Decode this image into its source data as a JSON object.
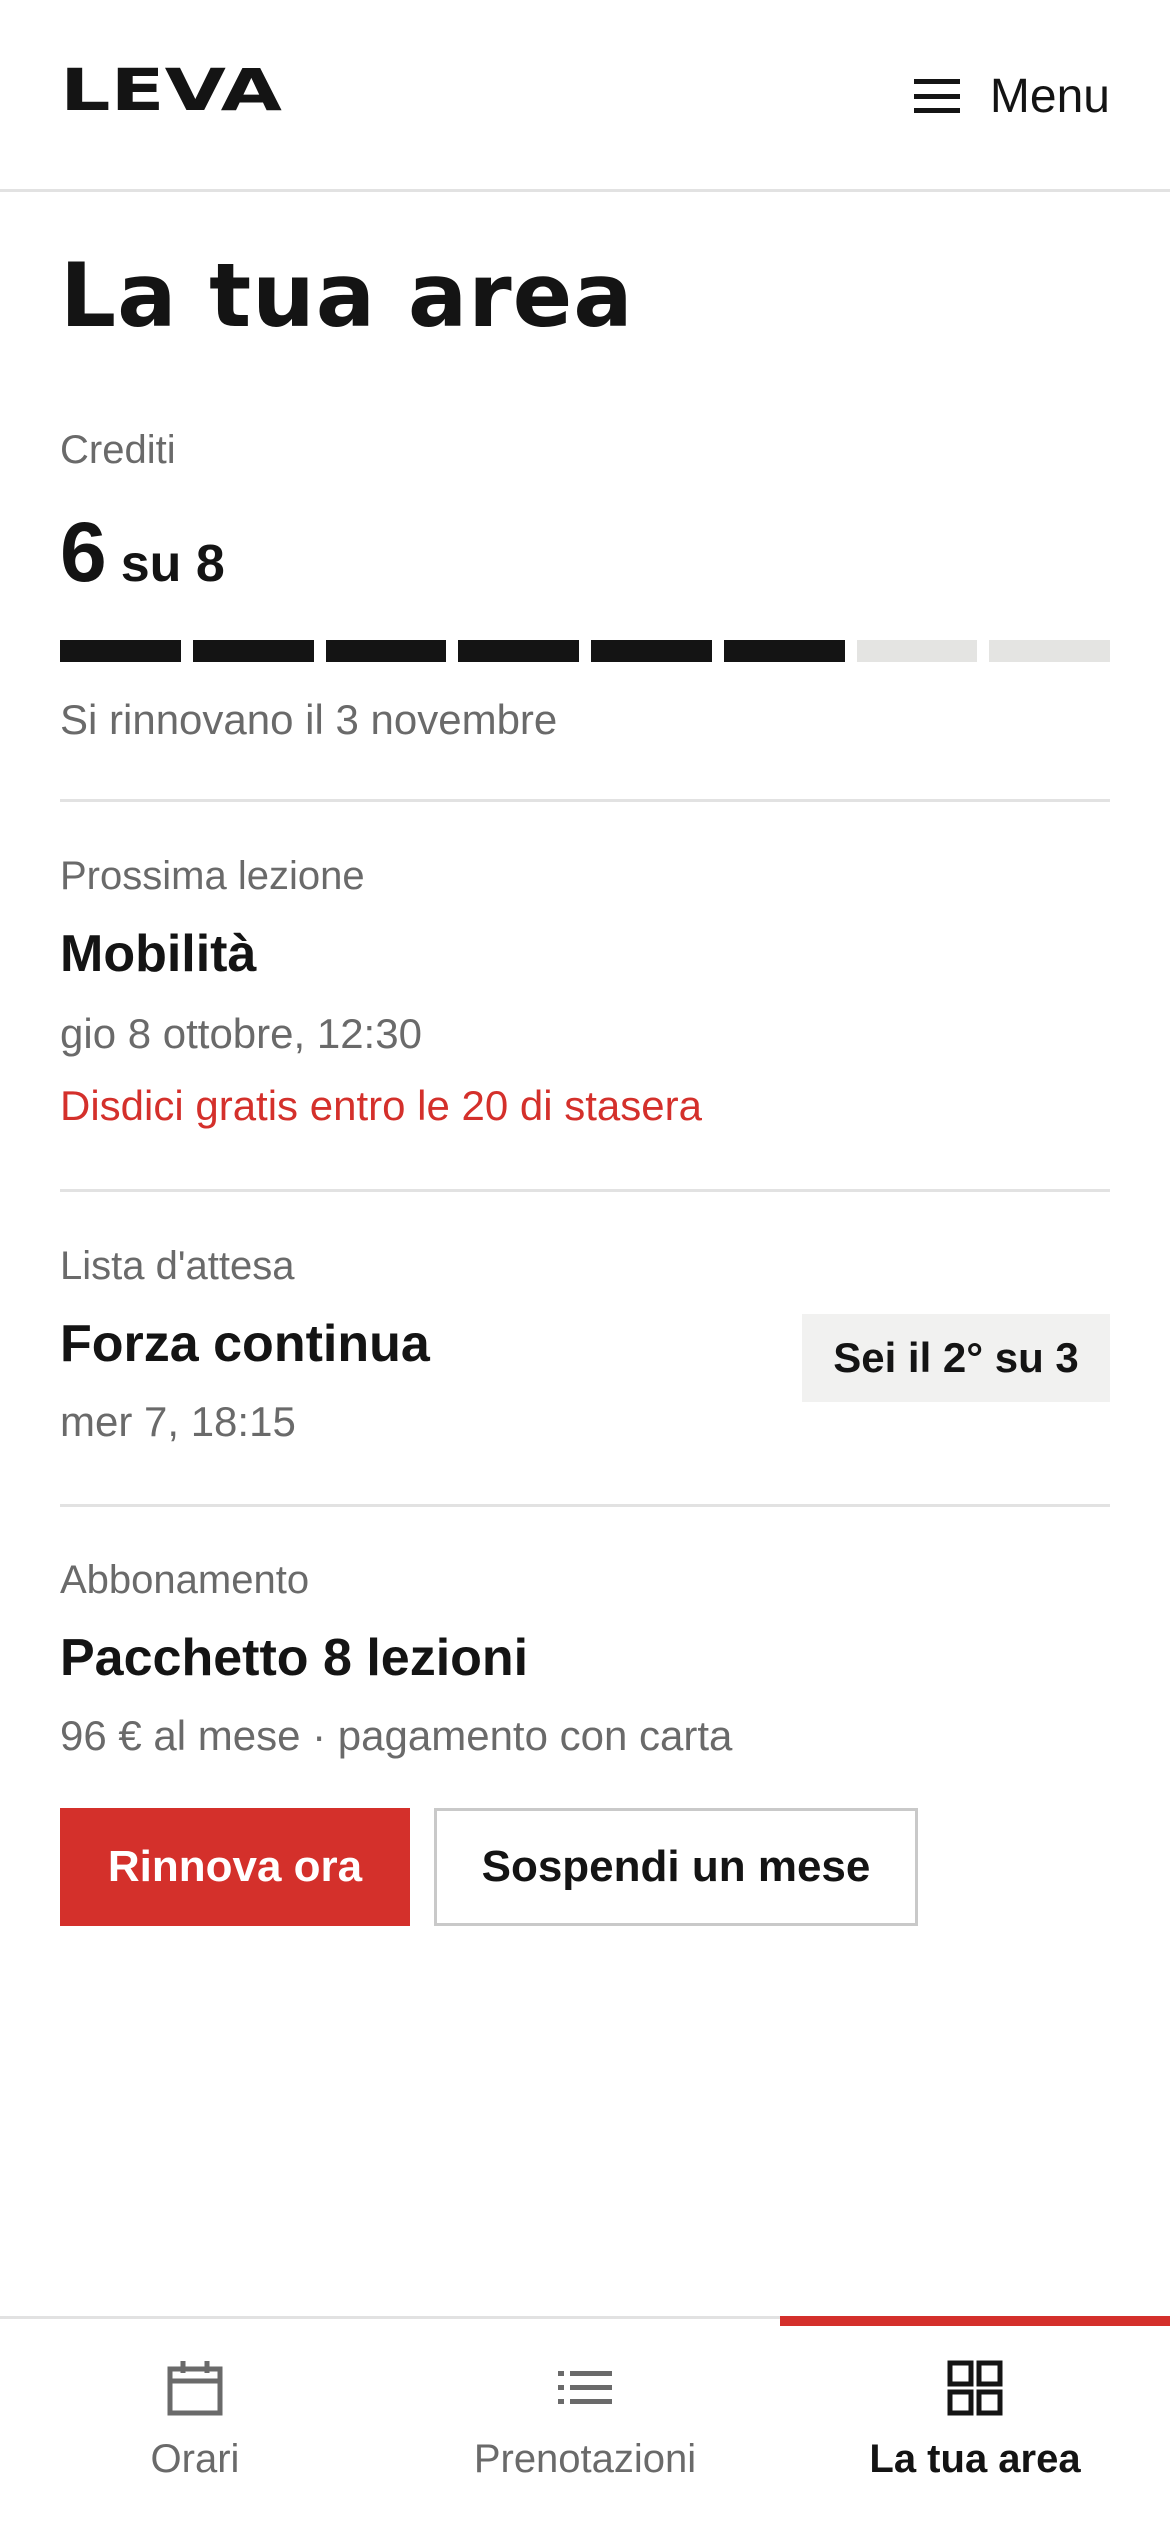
{
  "header": {
    "logo_text": "LEVA",
    "menu_label": "Menu"
  },
  "page": {
    "title": "La tua area"
  },
  "credits": {
    "label": "Crediti",
    "used": "6",
    "total_text": "su 8",
    "filled_segments": 6,
    "total_segments": 8,
    "renew_note": "Si rinnovano il 3 novembre"
  },
  "next_lesson": {
    "label": "Prossima lezione",
    "title": "Mobilità",
    "datetime": "gio 8 ottobre, 12:30",
    "cancel_note": "Disdici gratis entro le 20 di stasera"
  },
  "waitlist": {
    "label": "Lista d'attesa",
    "title": "Forza continua",
    "datetime": "mer 7, 18:15",
    "position_badge": "Sei il 2° su 3"
  },
  "subscription": {
    "label": "Abbonamento",
    "title": "Pacchetto 8 lezioni",
    "details": "96 € al mese · pagamento con carta",
    "renew_button": "Rinnova ora",
    "suspend_button": "Sospendi un mese"
  },
  "tabbar": {
    "tabs": [
      {
        "label": "Orari",
        "icon": "calendar-icon",
        "active": false
      },
      {
        "label": "Prenotazioni",
        "icon": "list-icon",
        "active": false
      },
      {
        "label": "La tua area",
        "icon": "grid-icon",
        "active": true
      }
    ]
  },
  "colors": {
    "accent": "#d4302b",
    "text": "#141414",
    "muted": "#6a6a6a",
    "divider": "#e2e2e2"
  }
}
